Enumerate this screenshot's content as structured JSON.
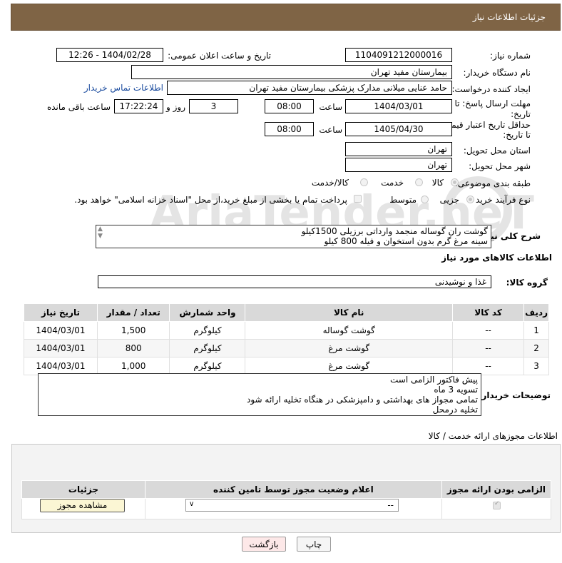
{
  "page_title": "جزئیات اطلاعات نیاز",
  "fields": {
    "need_number_label": "شماره نیاز:",
    "need_number": "1104091212000016",
    "announce_label": "تاریخ و ساعت اعلان عمومی:",
    "announce_value": "1404/02/28 - 12:26",
    "buyer_org_label": "نام دستگاه خریدار:",
    "buyer_org": "بیمارستان مفید تهران",
    "requester_label": "ایجاد کننده درخواست:",
    "requester": "حامد عنایی میلانی مدارک پزشکی بیمارستان مفید تهران",
    "contact_link": "اطلاعات تماس خریدار",
    "deadline_label_1": "مهلت ارسال پاسخ: تا",
    "deadline_label_2": "تاریخ:",
    "deadline_date": "1404/03/01",
    "time_label": "ساعت",
    "deadline_time": "08:00",
    "days_value": "3",
    "days_label": "روز و",
    "remaining_time": "17:22:24",
    "remaining_label": "ساعت باقی مانده",
    "validity_label_1": "حداقل تاریخ اعتبار قیمت:",
    "validity_label_2": "تا تاریخ:",
    "validity_date": "1405/04/30",
    "validity_time": "08:00",
    "province_label": "استان محل تحویل:",
    "province": "تهران",
    "city_label": "شهر محل تحویل:",
    "city": "تهران",
    "category_label": "طبقه بندی موضوعی:",
    "category_options": [
      "کالا",
      "خدمت",
      "کالا/خدمت"
    ],
    "process_label": "نوع فرآیند خرید :",
    "process_options": [
      "جزیی",
      "متوسط"
    ],
    "payment_note": "پرداخت تمام یا بخشی از مبلغ خرید،از محل \"اسناد خزانه اسلامی\" خواهد بود."
  },
  "summary": {
    "label": "شرح کلی نیاز:",
    "lines": [
      "گوشت ران گوساله منجمد وارداتی برزیلی 1500کیلو",
      "سینه مرغ گرم بدون استخوان و فیله 800 کیلو"
    ]
  },
  "goods_section_title": "اطلاعات کالاهای مورد نیاز",
  "goods_group_label": "گروه کالا:",
  "goods_group": "غذا و نوشیدنی",
  "goods_table": {
    "headers": [
      "ردیف",
      "کد کالا",
      "نام کالا",
      "واحد شمارش",
      "تعداد / مقدار",
      "تاریخ نیاز"
    ],
    "rows": [
      [
        "1",
        "--",
        "گوشت گوساله",
        "کیلوگرم",
        "1,500",
        "1404/03/01"
      ],
      [
        "2",
        "--",
        "گوشت مرغ",
        "کیلوگرم",
        "800",
        "1404/03/01"
      ],
      [
        "3",
        "--",
        "گوشت مرغ",
        "کیلوگرم",
        "1,000",
        "1404/03/01"
      ]
    ]
  },
  "buyer_notes": {
    "label": "توضیحات خریدار:",
    "lines": [
      "پیش فاکتور الزامی است",
      "تسویه 3 ماه",
      "تمامی مجواز های بهداشتی و دامپزشکی در هنگاه تخلیه ارائه شود",
      "تخلیه درمحل"
    ]
  },
  "permits_title": "اطلاعات مجوزهای ارائه خدمت / کالا",
  "permits_table": {
    "headers": [
      "الزامی بودن ارائه مجوز",
      "اعلام وضعیت مجوز توسط تامین کننده",
      "جزئیات"
    ],
    "select_value": "--",
    "view_button": "مشاهده مجوز"
  },
  "buttons": {
    "print": "چاپ",
    "back": "بازگشت"
  },
  "watermark_text": "AriaTender.neT",
  "colors": {
    "header_bg": "#7f6445",
    "link": "#1a4b9e",
    "back_button_bg": "#fde8e8"
  }
}
